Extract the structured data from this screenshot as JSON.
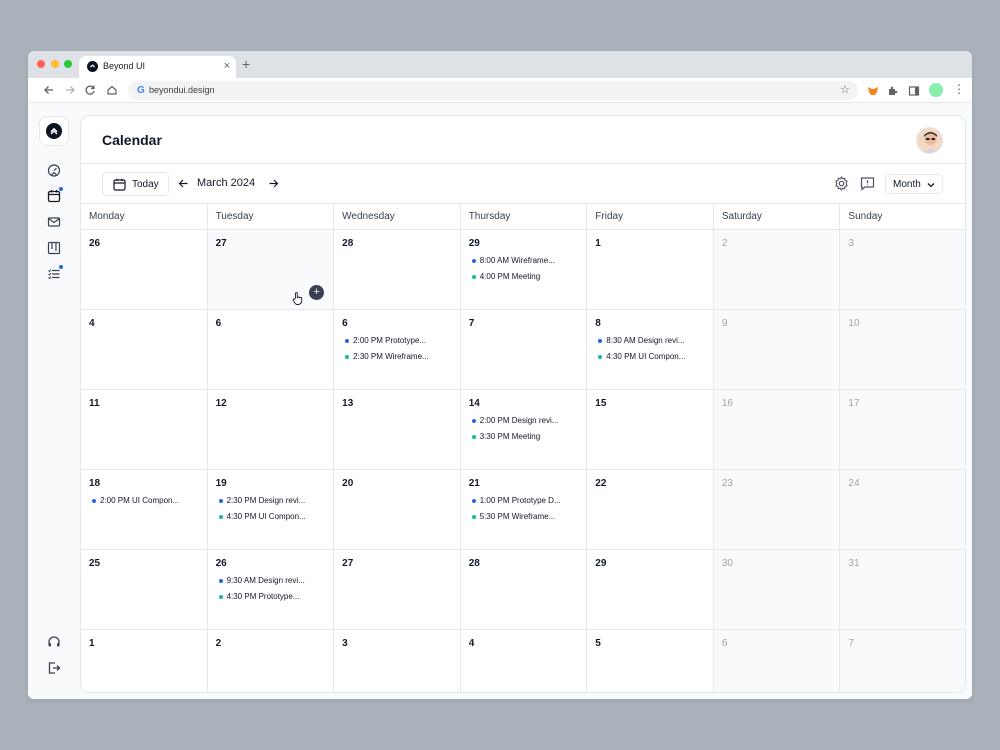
{
  "browser": {
    "tab_title": "Beyond UI",
    "tab_close": "×",
    "new_tab": "+",
    "url": "beyondui.design",
    "google_letter": "G"
  },
  "page": {
    "title": "Calendar"
  },
  "controls": {
    "today_label": "Today",
    "month_label": "March 2024",
    "view_label": "Month"
  },
  "colors": {
    "event_blue": "#2563eb",
    "event_teal": "#14b8a6"
  },
  "days_of_week": [
    "Monday",
    "Tuesday",
    "Wednesday",
    "Thursday",
    "Friday",
    "Saturday",
    "Sunday"
  ],
  "weeks": [
    [
      {
        "day": "26",
        "events": []
      },
      {
        "day": "27",
        "events": [],
        "hover": true
      },
      {
        "day": "28",
        "events": []
      },
      {
        "day": "29",
        "events": [
          {
            "text": "8:00 AM Wireframe...",
            "color": "blue"
          },
          {
            "text": "4:00 PM Meeting",
            "color": "teal"
          }
        ]
      },
      {
        "day": "1",
        "events": []
      },
      {
        "day": "2",
        "events": []
      },
      {
        "day": "3",
        "events": []
      }
    ],
    [
      {
        "day": "4",
        "events": []
      },
      {
        "day": "6",
        "events": []
      },
      {
        "day": "6",
        "events": [
          {
            "text": "2:00 PM Prototype...",
            "color": "blue"
          },
          {
            "text": "2:30 PM Wireframe...",
            "color": "teal"
          }
        ]
      },
      {
        "day": "7",
        "events": []
      },
      {
        "day": "8",
        "events": [
          {
            "text": "8:30 AM Design revi...",
            "color": "blue"
          },
          {
            "text": "4:30 PM UI Compon...",
            "color": "teal"
          }
        ]
      },
      {
        "day": "9",
        "events": []
      },
      {
        "day": "10",
        "events": []
      }
    ],
    [
      {
        "day": "11",
        "events": []
      },
      {
        "day": "12",
        "events": []
      },
      {
        "day": "13",
        "events": []
      },
      {
        "day": "14",
        "events": [
          {
            "text": "2:00 PM Design revi...",
            "color": "blue"
          },
          {
            "text": "3:30 PM Meeting",
            "color": "teal"
          }
        ]
      },
      {
        "day": "15",
        "events": []
      },
      {
        "day": "16",
        "events": []
      },
      {
        "day": "17",
        "events": []
      }
    ],
    [
      {
        "day": "18",
        "events": [
          {
            "text": "2:00 PM UI Compon...",
            "color": "blue"
          }
        ]
      },
      {
        "day": "19",
        "events": [
          {
            "text": "2:30 PM Design revi...",
            "color": "blue"
          },
          {
            "text": "4:30 PM UI Compon...",
            "color": "teal"
          }
        ]
      },
      {
        "day": "20",
        "events": []
      },
      {
        "day": "21",
        "events": [
          {
            "text": "1:00 PM Prototype D...",
            "color": "blue"
          },
          {
            "text": "5:30 PM Wireframe...",
            "color": "teal"
          }
        ]
      },
      {
        "day": "22",
        "events": []
      },
      {
        "day": "23",
        "events": []
      },
      {
        "day": "24",
        "events": []
      }
    ],
    [
      {
        "day": "25",
        "events": []
      },
      {
        "day": "26",
        "events": [
          {
            "text": "9:30 AM Design revi...",
            "color": "blue"
          },
          {
            "text": "4:30 PM Prototype...",
            "color": "teal"
          }
        ]
      },
      {
        "day": "27",
        "events": []
      },
      {
        "day": "28",
        "events": []
      },
      {
        "day": "29",
        "events": []
      },
      {
        "day": "30",
        "events": []
      },
      {
        "day": "31",
        "events": []
      }
    ],
    [
      {
        "day": "1",
        "events": []
      },
      {
        "day": "2",
        "events": []
      },
      {
        "day": "3",
        "events": []
      },
      {
        "day": "4",
        "events": []
      },
      {
        "day": "5",
        "events": []
      },
      {
        "day": "6",
        "events": []
      },
      {
        "day": "7",
        "events": []
      }
    ]
  ],
  "add_event_symbol": "+",
  "icons": {
    "sidebar": [
      "dashboard-icon",
      "calendar-icon",
      "mail-icon",
      "kanban-icon",
      "tasks-icon",
      "headset-icon",
      "logout-icon"
    ]
  }
}
